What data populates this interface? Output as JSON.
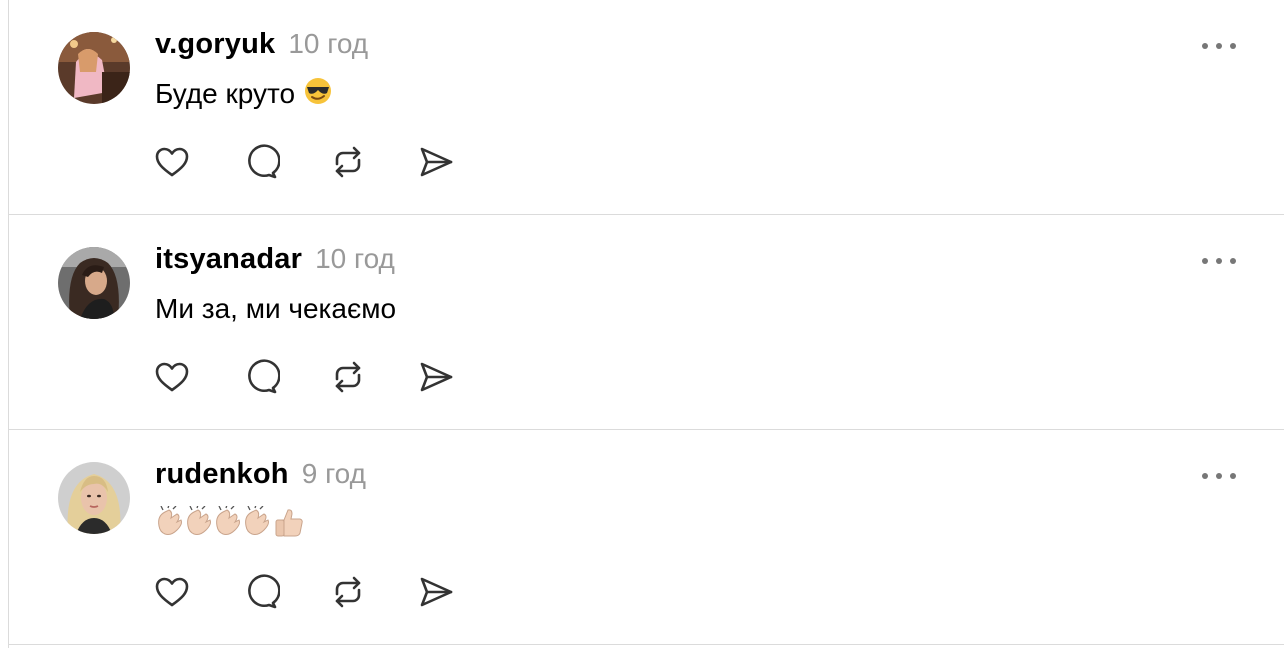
{
  "posts": [
    {
      "username": "v.goryuk",
      "time": "10 год",
      "text": "Буде круто ",
      "emoji": "sunglasses-emoji"
    },
    {
      "username": "itsyanadar",
      "time": "10 год",
      "text": "Ми за, ми чекаємо"
    },
    {
      "username": "rudenkoh",
      "time": "9 год",
      "text": "",
      "emoji": "clapping-hands-thumbs-up-emoji"
    }
  ],
  "icons": {
    "like": "heart-icon",
    "reply": "speech-bubble-icon",
    "repost": "repost-icon",
    "share": "send-icon",
    "more": "more-options-icon"
  },
  "colors": {
    "text": "#000000",
    "muted": "#999999",
    "icon": "#333333",
    "divider": "#dbdbdb"
  }
}
